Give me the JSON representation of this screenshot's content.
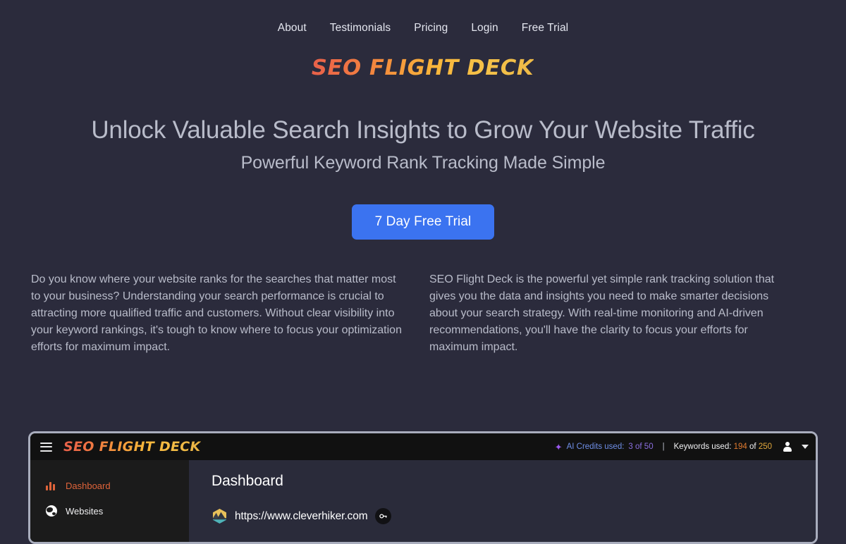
{
  "nav": {
    "items": [
      {
        "label": "About"
      },
      {
        "label": "Testimonials"
      },
      {
        "label": "Pricing"
      },
      {
        "label": "Login"
      },
      {
        "label": "Free Trial"
      }
    ]
  },
  "brand": {
    "name": "SEO FLIGHT DECK",
    "gradient_start": "#e8604a",
    "gradient_end": "#eeba47"
  },
  "hero": {
    "headline": "Unlock Valuable Search Insights to Grow Your Website Traffic",
    "subheadline": "Powerful Keyword Rank Tracking Made Simple",
    "cta_label": "7 Day Free Trial",
    "cta_color": "#3b73f0"
  },
  "body_columns": {
    "left": "Do you know where your website ranks for the searches that matter most to your business? Understanding your search performance is crucial to attracting more qualified traffic and customers. Without clear visibility into your keyword rankings, it's tough to know where to focus your optimization efforts for maximum impact.",
    "right": "SEO Flight Deck is the powerful yet simple rank tracking solution that gives you the data and insights you need to make smarter decisions about your search strategy. With real-time monitoring and AI-driven recommendations, you'll have the clarity to focus your efforts for maximum impact."
  },
  "dashboard": {
    "header": {
      "menu_icon": "hamburger-icon",
      "logo": "SEO FLIGHT DECK",
      "ai_credits_icon": "sparkle-icon",
      "ai_credits_label": "AI Credits used:",
      "ai_credits_value": "3 of 50",
      "divider": "|",
      "keywords_label": "Keywords used:",
      "keywords_used": "194",
      "keywords_of": "of",
      "keywords_total": "250",
      "account_icon": "user-avatar-icon",
      "dropdown_icon": "chevron-down-icon"
    },
    "sidebar": {
      "items": [
        {
          "label": "Dashboard",
          "icon": "bar-chart-icon",
          "active": true
        },
        {
          "label": "Websites",
          "icon": "globe-icon",
          "active": false
        }
      ]
    },
    "main": {
      "title": "Dashboard",
      "site": {
        "favicon": "mountain-hexagon-favicon",
        "url": "https://www.cleverhiker.com",
        "action_icon": "key-icon"
      }
    }
  }
}
